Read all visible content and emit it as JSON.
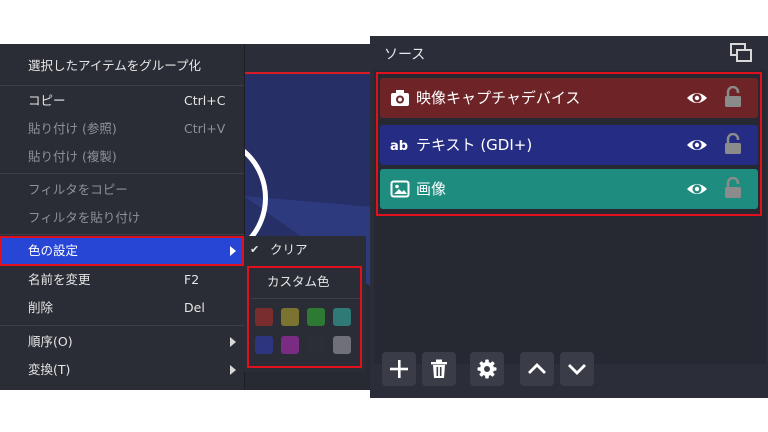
{
  "context_menu": {
    "items": [
      {
        "label": "選択したアイテムをグループ化",
        "shortcut": "",
        "disabled": false
      },
      {
        "label": "コピー",
        "shortcut": "Ctrl+C",
        "disabled": false
      },
      {
        "label": "貼り付け (参照)",
        "shortcut": "Ctrl+V",
        "disabled": true
      },
      {
        "label": "貼り付け (複製)",
        "shortcut": "",
        "disabled": true
      },
      {
        "label": "フィルタをコピー",
        "shortcut": "",
        "disabled": true
      },
      {
        "label": "フィルタを貼り付け",
        "shortcut": "",
        "disabled": true
      },
      {
        "label": "色の設定",
        "shortcut": "",
        "disabled": false,
        "submenu": true
      },
      {
        "label": "名前を変更",
        "shortcut": "F2",
        "disabled": false
      },
      {
        "label": "削除",
        "shortcut": "Del",
        "disabled": false
      },
      {
        "label": "順序(O)",
        "shortcut": "",
        "disabled": false,
        "submenu": true
      },
      {
        "label": "変換(T)",
        "shortcut": "",
        "disabled": false,
        "submenu": true
      }
    ]
  },
  "color_submenu": {
    "clear_label": "クリア",
    "check_icon": "check-icon",
    "custom_label": "カスタム色",
    "swatch_colors": [
      "#7a2d2f",
      "#7a7430",
      "#2f7a33",
      "#2f7a77",
      "#2d3480",
      "#7a2c83",
      "#2c2e36",
      "#6f7079"
    ]
  },
  "sources_dock": {
    "title": "ソース",
    "sources": [
      {
        "name": "映像キャプチャデバイス",
        "icon": "camera-icon",
        "color": "#6e2427"
      },
      {
        "name": "テキスト (GDI+)",
        "icon": "text-ab-icon",
        "color": "#252c84"
      },
      {
        "name": "画像",
        "icon": "image-icon",
        "color": "#1f8c80"
      }
    ],
    "toolbar": [
      "add-icon",
      "trash-icon",
      "gear-icon",
      "chevron-up-icon",
      "chevron-down-icon"
    ]
  }
}
